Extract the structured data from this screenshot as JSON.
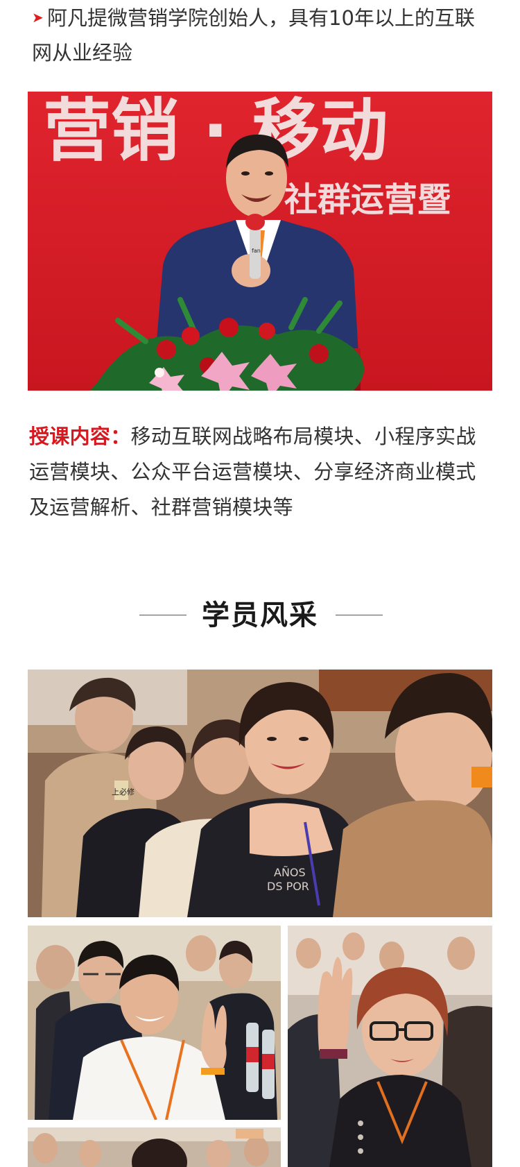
{
  "intro": {
    "text": "阿凡提微营销学院创始人，具有10年以上的互联网从业经验"
  },
  "speaker_photo": {
    "banner_text_top": "营销 · 移动",
    "banner_text_sub": "社群运营暨",
    "mic_label": "fan",
    "colors": {
      "banner": "#d81f2a",
      "banner_text": "#f4e9e9",
      "suit": "#27356e"
    }
  },
  "course": {
    "label": "授课内容：",
    "text": "移动互联网战略布局模块、小程序实战运营模块、公众平台运营模块、分享经济商业模式及运营解析、社群营销模块等"
  },
  "section": {
    "title": "学员风采"
  },
  "group_photo": {
    "badge_text": "上必修",
    "shirt_text_1": "AÑOS",
    "shirt_text_2": "DS POR"
  },
  "colors": {
    "accent": "#d7191f",
    "text": "#333333"
  }
}
